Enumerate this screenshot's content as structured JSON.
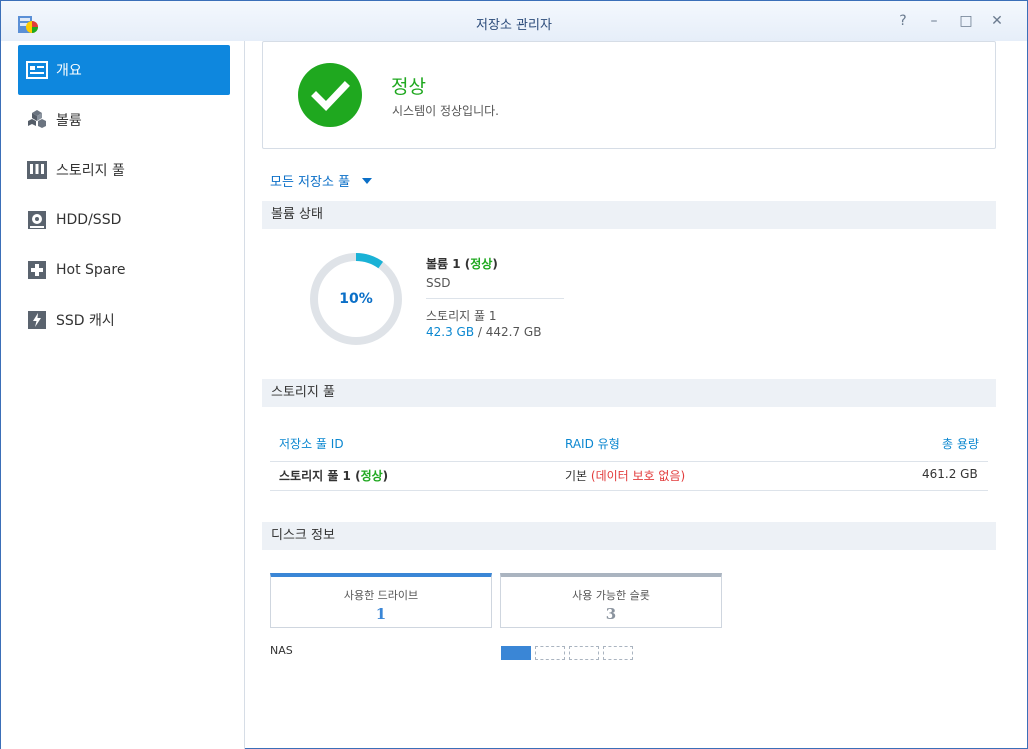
{
  "window": {
    "title": "저장소 관리자",
    "controls": {
      "help": "?",
      "minimize": "–",
      "maximize": "□",
      "close": "✕"
    }
  },
  "sidebar": {
    "items": [
      {
        "label": "개요",
        "icon": "overview-icon",
        "active": true
      },
      {
        "label": "볼륨",
        "icon": "volume-cubes-icon",
        "active": false
      },
      {
        "label": "스토리지 풀",
        "icon": "storage-pool-icon",
        "active": false
      },
      {
        "label": "HDD/SSD",
        "icon": "disk-icon",
        "active": false
      },
      {
        "label": "Hot Spare",
        "icon": "hot-spare-plus-icon",
        "active": false
      },
      {
        "label": "SSD 캐시",
        "icon": "ssd-cache-bolt-icon",
        "active": false
      }
    ]
  },
  "status": {
    "title": "정상",
    "subtitle": "시스템이 정상입니다.",
    "color": "#1fa81f"
  },
  "pool_filter": {
    "selected": "모든 저장소 풀"
  },
  "volume_section": {
    "heading": "볼륨 상태",
    "usage_percent_label": "10%",
    "usage_fraction": 0.1,
    "volume_name": "볼륨 1",
    "volume_status": "정상",
    "open_paren": "(",
    "close_paren": ")",
    "volume_type": "SSD",
    "pool_name": "스토리지 풀 1",
    "used": "42.3 GB",
    "separator": " / ",
    "total": "442.7 GB"
  },
  "pool_section": {
    "heading": "스토리지 풀",
    "columns": [
      "저장소 풀 ID",
      "RAID 유형",
      "총 용량"
    ],
    "rows": [
      {
        "name": "스토리지 풀 1",
        "status": "정상",
        "raid_base": "기본",
        "raid_note": "(데이터 보호 없음)",
        "capacity": "461.2 GB"
      }
    ]
  },
  "disk_section": {
    "heading": "디스크 정보",
    "cards": [
      {
        "label": "사용한 드라이브",
        "value": "1",
        "accent": "#3a86d6"
      },
      {
        "label": "사용 가능한 슬롯",
        "value": "3",
        "accent": "#aab4c0"
      }
    ],
    "device_label": "NAS",
    "slots_filled": 1,
    "slots_total": 4
  },
  "colors": {
    "accent": "#0e87de",
    "ok": "#1fa81f",
    "warn": "#e23b3b",
    "link": "#0b87d0"
  }
}
